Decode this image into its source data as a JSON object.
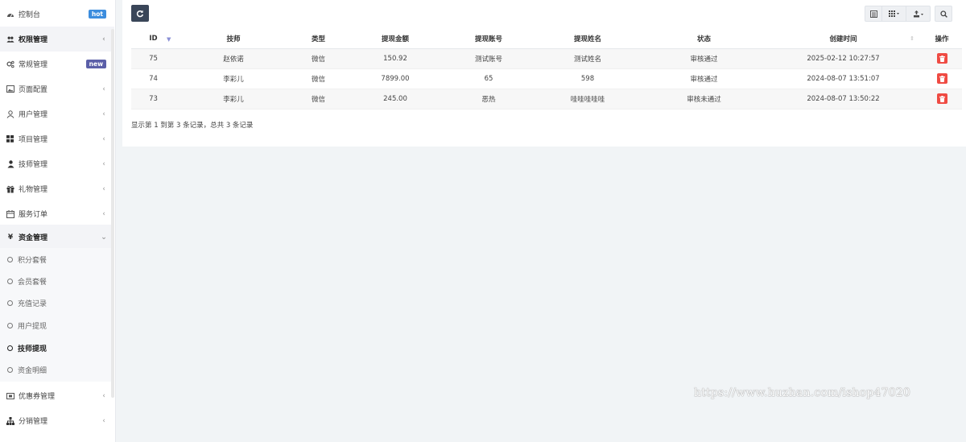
{
  "sidebar": {
    "items": [
      {
        "label": "控制台",
        "icon": "dashboard-icon",
        "badge": "hot"
      },
      {
        "label": "权限管理",
        "icon": "users-icon",
        "chevron": "‹"
      },
      {
        "label": "常规管理",
        "icon": "cogs-icon",
        "badge": "new"
      },
      {
        "label": "页面配置",
        "icon": "image-icon",
        "chevron": "‹"
      },
      {
        "label": "用户管理",
        "icon": "user-icon",
        "chevron": "‹"
      },
      {
        "label": "项目管理",
        "icon": "grid-icon",
        "chevron": "‹"
      },
      {
        "label": "技师管理",
        "icon": "person-icon",
        "chevron": "‹"
      },
      {
        "label": "礼物管理",
        "icon": "gift-icon",
        "chevron": "‹"
      },
      {
        "label": "服务订单",
        "icon": "calendar-icon",
        "chevron": "‹"
      },
      {
        "label": "资金管理",
        "icon": "yen-icon",
        "chevron": "⌄"
      },
      {
        "label": "优惠券管理",
        "icon": "ticket-icon",
        "chevron": "‹"
      },
      {
        "label": "分销管理",
        "icon": "sitemap-icon",
        "chevron": "‹"
      }
    ],
    "sub_items": [
      {
        "label": "积分套餐"
      },
      {
        "label": "会员套餐"
      },
      {
        "label": "充值记录"
      },
      {
        "label": "用户提现"
      },
      {
        "label": "技师提现"
      },
      {
        "label": "资金明细"
      }
    ]
  },
  "table": {
    "columns": [
      "ID",
      "技师",
      "类型",
      "提现金额",
      "提现账号",
      "提现姓名",
      "状态",
      "创建时间",
      "操作"
    ],
    "rows": [
      {
        "id": "75",
        "tech": "赵依诺",
        "type": "微信",
        "amount": "150.92",
        "account": "测试账号",
        "name": "测试姓名",
        "status": "审核通过",
        "created": "2025-02-12 10:27:57"
      },
      {
        "id": "74",
        "tech": "李彩儿",
        "type": "微信",
        "amount": "7899.00",
        "account": "65",
        "name": "598",
        "status": "审核通过",
        "created": "2024-08-07 13:51:07"
      },
      {
        "id": "73",
        "tech": "李彩儿",
        "type": "微信",
        "amount": "245.00",
        "account": "恶热",
        "name": "哇哇哇哇哇",
        "status": "审核未通过",
        "created": "2024-08-07 13:50:22"
      }
    ]
  },
  "pagination": {
    "summary": "显示第 1 到第 3 条记录，总共 3 条记录"
  },
  "watermark": "https://www.huzhan.com/ishop47020",
  "colors": {
    "accent": "#3a4659",
    "delete": "#ef4b43",
    "badge_hot": "#3c8dde",
    "badge_new": "#5b5fa8"
  }
}
